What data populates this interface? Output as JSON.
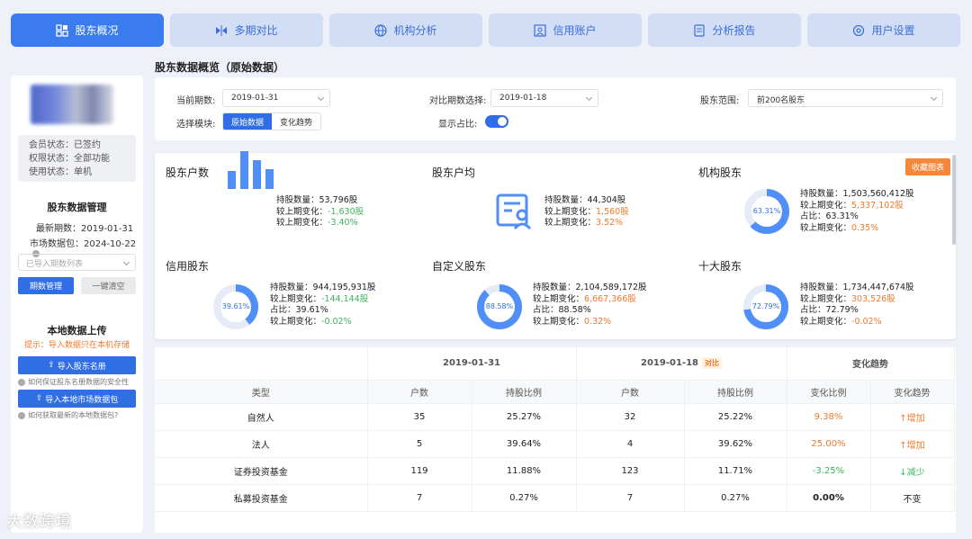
{
  "nav": {
    "tabs": [
      {
        "label": "股东概况",
        "icon": "grid-icon",
        "active": true
      },
      {
        "label": "多期对比",
        "icon": "compare-icon"
      },
      {
        "label": "机构分析",
        "icon": "globe-icon"
      },
      {
        "label": "信用账户",
        "icon": "id-card-icon"
      },
      {
        "label": "分析报告",
        "icon": "report-icon"
      },
      {
        "label": "用户设置",
        "icon": "settings-icon"
      }
    ]
  },
  "sidebar": {
    "member_status": "会员状态：已签约",
    "permission_status": "权限状态：全部功能",
    "usage_status": "使用状态：单机",
    "data_mgmt_title": "股东数据管理",
    "latest_period": "最新期数：2019-01-31",
    "market_data": "市场数据包：2024-10-22",
    "imported_periods_placeholder": "已导入期数列表",
    "period_mgmt_btn": "期数管理",
    "clear_btn": "一键清空",
    "upload_title": "本地数据上传",
    "upload_hint": "提示：导入数据只在本机存储",
    "import_roster_btn": "导入股东名册",
    "roster_security_link": "如何保证股东名册数据的安全性",
    "import_market_btn": "导入本地市场数据包",
    "get_market_link": "如何获取最新的本地数据包?"
  },
  "page_title": "股东数据概览（原始数据）",
  "filters": {
    "current_period_label": "当前期数:",
    "current_period_value": "2019-01-31",
    "compare_period_label": "对比期数选择:",
    "compare_period_value": "2019-01-18",
    "range_label": "股东范围:",
    "range_value": "前200名股东",
    "module_label": "选择模块:",
    "module_options": [
      "原始数据",
      "变化趋势"
    ],
    "show_ratio_label": "显示占比:",
    "show_ratio_on": true
  },
  "cards": {
    "collect_btn": "收藏图表",
    "holder_count": {
      "title": "股东户数",
      "l1": "持股数量：53,796股",
      "l2a": "较上期变化：",
      "l2b": "-1,630股",
      "l3a": "较上期变化：",
      "l3b": "-3.40%"
    },
    "avg_holding": {
      "title": "股东户均",
      "l1": "持股数量：44,304股",
      "l2a": "较上期变化：",
      "l2b": "1,560股",
      "l3a": "较上期变化：",
      "l3b": "3.52%"
    },
    "institution": {
      "title": "机构股东",
      "pct": "63.31%",
      "ratio": 0.6331,
      "l1": "持股数量：1,503,560,412股",
      "l2a": "较上期变化：",
      "l2b": "5,337,102股",
      "l3": "占比：63.31%",
      "l4a": "较上期变化：",
      "l4b": "0.35%"
    },
    "credit": {
      "title": "信用股东",
      "pct": "39.61%",
      "ratio": 0.3961,
      "l1": "持股数量：944,195,931股",
      "l2a": "较上期变化：",
      "l2b": "-144,144股",
      "l3": "占比：39.61%",
      "l4a": "较上期变化：",
      "l4b": "-0.02%"
    },
    "custom": {
      "title": "自定义股东",
      "pct": "88.58%",
      "ratio": 0.8858,
      "l1": "持股数量：2,104,589,172股",
      "l2a": "较上期变化：",
      "l2b": "6,667,366股",
      "l3": "占比：88.58%",
      "l4a": "较上期变化：",
      "l4b": "0.32%"
    },
    "top10": {
      "title": "十大股东",
      "pct": "72.79%",
      "ratio": 0.7279,
      "l1": "持股数量：1,734,447,674股",
      "l2a": "较上期变化：",
      "l2b": "303,526股",
      "l3": "占比：72.79%",
      "l4a": "较上期变化：",
      "l4b": "-0.02%"
    }
  },
  "table": {
    "period1": "2019-01-31",
    "period2": "2019-01-18",
    "period2_tag": "对比",
    "trend_group": "变化趋势",
    "headers": [
      "类型",
      "户数",
      "持股比例",
      "户数",
      "持股比例",
      "变化比例",
      "变化趋势"
    ],
    "rows": [
      {
        "type": "自然人",
        "c1": "35",
        "r1": "25.27%",
        "c2": "32",
        "r2": "25.22%",
        "chg": "9.38%",
        "trend": "↑增加",
        "dir": "up"
      },
      {
        "type": "法人",
        "c1": "5",
        "r1": "39.64%",
        "c2": "4",
        "r2": "39.62%",
        "chg": "25.00%",
        "trend": "↑增加",
        "dir": "up"
      },
      {
        "type": "证券投资基金",
        "c1": "119",
        "r1": "11.88%",
        "c2": "123",
        "r2": "11.71%",
        "chg": "-3.25%",
        "trend": "↓减少",
        "dir": "down"
      },
      {
        "type": "私募投资基金",
        "c1": "7",
        "r1": "0.27%",
        "c2": "7",
        "r2": "0.27%",
        "chg": "0.00%",
        "trend": "不变",
        "dir": "flat"
      }
    ]
  },
  "watermark": "大数跨境",
  "colors": {
    "accent": "#2f6ee5",
    "up": "#f07a2b",
    "down": "#3fb45f",
    "tab_bg": "#d2ddf6"
  }
}
